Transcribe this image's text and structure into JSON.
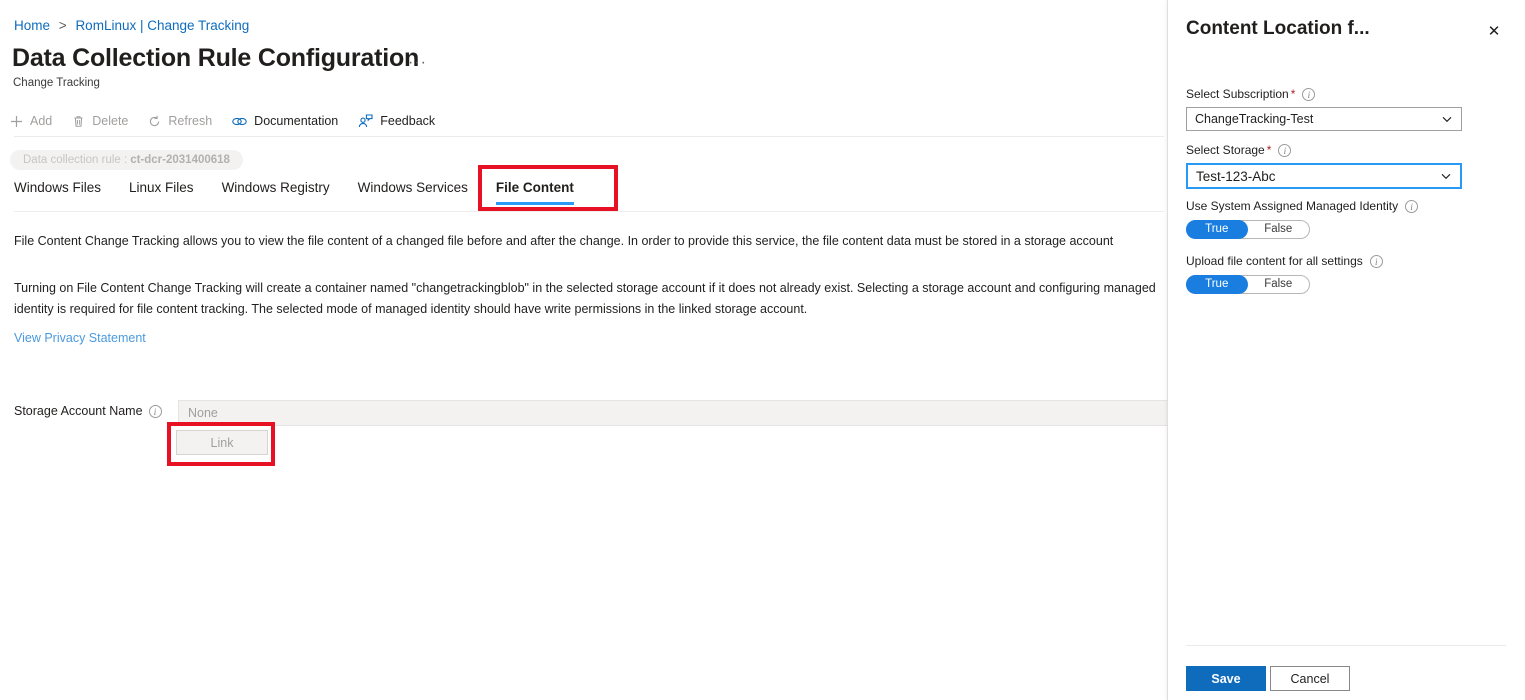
{
  "breadcrumb": {
    "home": "Home",
    "separator": ">",
    "current": "RomLinux | Change Tracking"
  },
  "header": {
    "title": "Data Collection Rule Configuration",
    "ellipsis": "···",
    "subtitle": "Change Tracking"
  },
  "command_bar": {
    "items": [
      {
        "label": "Add",
        "icon": "plus-icon",
        "enabled": false
      },
      {
        "label": "Delete",
        "icon": "trash-icon",
        "enabled": false
      },
      {
        "label": "Refresh",
        "icon": "refresh-icon",
        "enabled": false
      },
      {
        "label": "Documentation",
        "icon": "links-icon",
        "enabled": true
      },
      {
        "label": "Feedback",
        "icon": "person-feedback-icon",
        "enabled": true
      }
    ]
  },
  "context_chip": {
    "prefix": "Data collection rule :",
    "value": "ct-dcr-2031400618"
  },
  "tabs": [
    {
      "label": "Windows Files",
      "active": false
    },
    {
      "label": "Linux Files",
      "active": false
    },
    {
      "label": "Windows Registry",
      "active": false
    },
    {
      "label": "Windows Services",
      "active": false
    },
    {
      "label": "File Content",
      "active": true
    }
  ],
  "content": {
    "paragraph1": "File Content Change Tracking allows you to view the file content of a changed file before and after the change. In order to provide this service, the file content data must be stored in a storage account",
    "paragraph2": "Turning on File Content Change Tracking will create a container named \"changetrackingblob\" in the selected storage account if it does not already exist. Selecting a storage account and configuring managed identity is required for file content tracking. The selected mode of managed identity should have write permissions in the linked storage account.",
    "privacy_link": "View Privacy Statement",
    "storage_account_label": "Storage Account Name",
    "storage_account_value": "None",
    "link_button": "Link"
  },
  "panel": {
    "title": "Content Location f...",
    "close_icon": "✕",
    "subscription": {
      "label": "Select Subscription",
      "required_marker": "*",
      "value": "ChangeTracking-Test"
    },
    "storage": {
      "label": "Select Storage",
      "required_marker": "*",
      "value": "Test-123-Abc"
    },
    "managed_identity": {
      "label": "Use System Assigned Managed Identity",
      "on_label": "True",
      "off_label": "False",
      "selected": "True"
    },
    "upload_all": {
      "label": "Upload file content for all settings",
      "on_label": "True",
      "off_label": "False",
      "selected": "True"
    },
    "save_label": "Save",
    "cancel_label": "Cancel"
  },
  "colors": {
    "accent_blue": "#0f6cbd",
    "tab_underline": "#2899f5",
    "toggle_on": "#1a7ee0",
    "annotation_red": "#e81123",
    "required_red": "#a4262c"
  }
}
